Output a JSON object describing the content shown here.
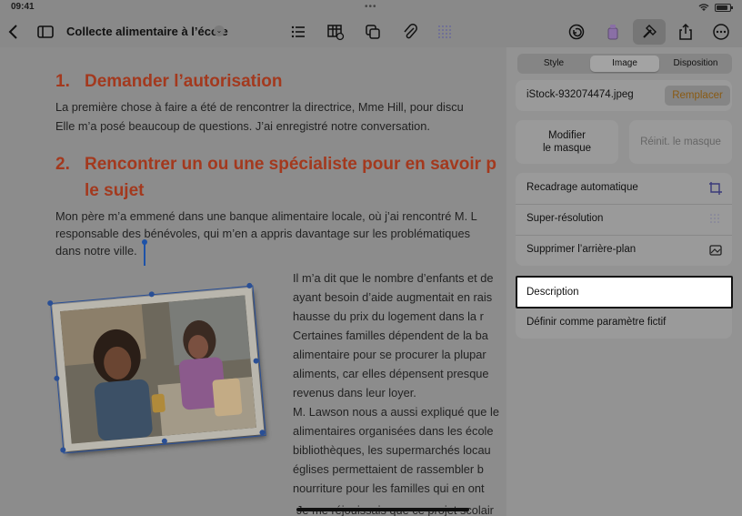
{
  "status": {
    "time": "09:41",
    "dots": "•••"
  },
  "toolbar": {
    "title": "Collecte alimentaire à l’école",
    "title_chevron": "⌄"
  },
  "document": {
    "heading1": {
      "number": "1.",
      "text": "Demander l’autorisation"
    },
    "para1": [
      "La première chose à faire a été de rencontrer la directrice, Mme Hill, pour discu",
      "Elle m’a posé beaucoup de questions. J’ai enregistré notre conversation."
    ],
    "heading2": {
      "number": "2.",
      "line1": "Rencontrer un ou une spécialiste pour en savoir p",
      "line2": "le sujet"
    },
    "para2": [
      "Mon père m’a emmené dans une banque alimentaire locale, où j’ai rencontré M. L",
      "responsable des bénévoles, qui m’en a appris davantage sur les problématiques",
      "dans notre ville."
    ],
    "para3": [
      "Il m’a dit que le nombre d’enfants et de",
      "ayant besoin d’aide augmentait en rais",
      "hausse du prix du logement dans la r",
      "Certaines familles dépendent de la ba",
      "alimentaire pour se procurer la plupar",
      "aliments, car elles dépensent presque",
      "revenus dans leur loyer."
    ],
    "para4": [
      "M. Lawson nous a aussi expliqué que le",
      "alimentaires organisées dans les école",
      "bibliothèques, les supermarchés locau",
      "églises permettaient de rassembler b",
      "nourriture pour les familles qui en ont"
    ],
    "para5": "Je me réjouissais que ce projet scolair"
  },
  "inspector": {
    "tabs": [
      "Style",
      "Image",
      "Disposition"
    ],
    "selected_tab": "Image",
    "file_name": "iStock-932074474.jpeg",
    "replace_label": "Remplacer",
    "modify_mask_label": [
      "Modifier",
      "le masque"
    ],
    "reset_mask_label": "Réinit. le masque",
    "options": [
      {
        "label": "Recadrage automatique",
        "icon": "crop-icon"
      },
      {
        "label": "Super-résolution",
        "icon": "grid-dots-icon"
      },
      {
        "label": "Supprimer l’arrière-plan",
        "icon": "remove-background-icon"
      }
    ],
    "description_label": "Description",
    "placeholder_label": "Définir comme paramètre fictif"
  },
  "colors": {
    "accent_heading": "#a3391e",
    "replace_text": "#8a5a12",
    "selection": "#2a4f95"
  }
}
